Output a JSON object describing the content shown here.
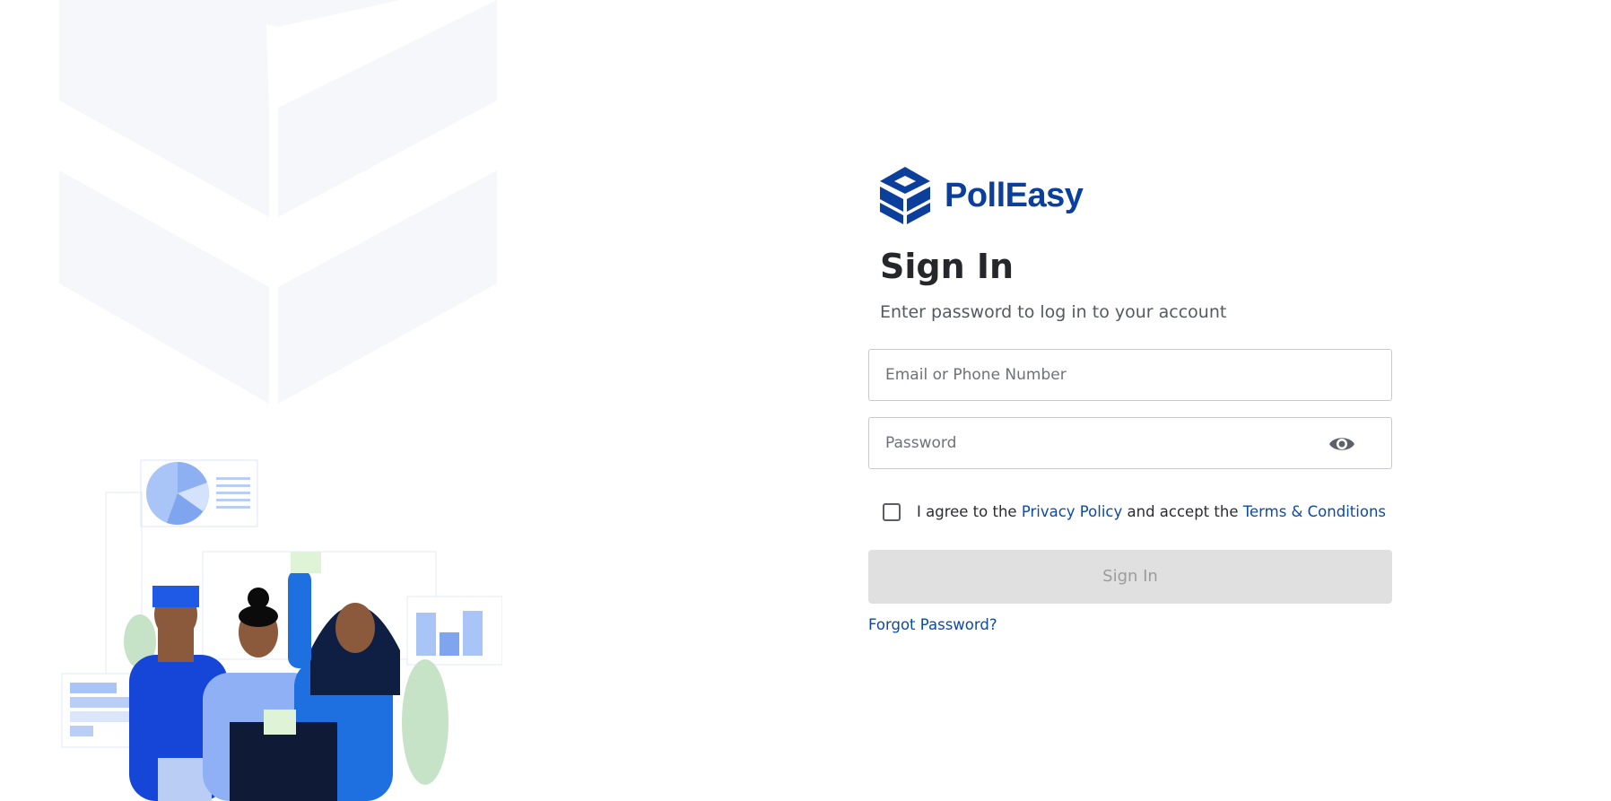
{
  "brand": {
    "name": "PollEasy",
    "color": "#0c3e9c"
  },
  "form": {
    "title": "Sign In",
    "subtitle": "Enter password to log in to your account",
    "email_placeholder": "Email or Phone Number",
    "password_placeholder": "Password",
    "agree_prefix": "I agree to the ",
    "privacy_link": "Privacy Policy",
    "agree_middle": " and accept the ",
    "terms_link": "Terms & Conditions",
    "submit_label": "Sign In",
    "forgot_label": "Forgot Password?"
  },
  "colors": {
    "accent": "#0c4aa8",
    "disabled_button": "#e0e0e0"
  },
  "icons": {
    "password_toggle": "eye-icon",
    "logo": "polleasy-cube-logo"
  }
}
